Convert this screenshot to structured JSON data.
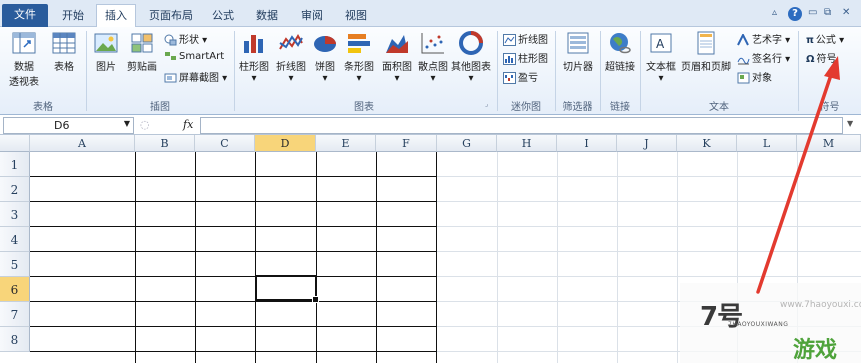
{
  "tabs": [
    "文件",
    "开始",
    "插入",
    "页面布局",
    "公式",
    "数据",
    "审阅",
    "视图"
  ],
  "ribbon": {
    "groups": {
      "tables": "表格",
      "illustrations": "插图",
      "charts": "图表",
      "sparklines": "迷你图",
      "filter": "筛选器",
      "links": "链接",
      "text": "文本",
      "symbols": "符号"
    },
    "tables": {
      "pivot_line1": "数据",
      "pivot_line2": "透视表",
      "table": "表格"
    },
    "illustrations": {
      "picture": "图片",
      "clipart": "剪贴画",
      "shapes": "形状",
      "smartart": "SmartArt",
      "screenshot": "屏幕截图"
    },
    "charts": {
      "column": "柱形图",
      "line": "折线图",
      "pie": "饼图",
      "bar": "条形图",
      "area": "面积图",
      "scatter": "散点图",
      "other": "其他图表"
    },
    "sparklines": {
      "line": "折线图",
      "column": "柱形图",
      "winloss": "盈亏"
    },
    "filter": {
      "slicer": "切片器"
    },
    "links": {
      "hyperlink": "超链接"
    },
    "text": {
      "textbox": "文本框",
      "header_footer": "页眉和页脚",
      "wordart": "艺术字",
      "signature": "签名行",
      "object": "对象"
    },
    "symbols": {
      "equation": "公式",
      "symbol": "符号"
    }
  },
  "formula_bar": {
    "name_box": "D6",
    "fx": "fx",
    "value": ""
  },
  "columns": [
    "A",
    "B",
    "C",
    "D",
    "E",
    "F",
    "G",
    "H",
    "I",
    "J",
    "K",
    "L",
    "M"
  ],
  "rows": [
    "1",
    "2",
    "3",
    "4",
    "5",
    "6",
    "7",
    "8"
  ],
  "selected": {
    "column": "D",
    "row": "6"
  },
  "watermark": {
    "brand": "7号",
    "site": "www.7haoyouxi.com",
    "sub": "7HAOYOUXIWANG",
    "green": "游戏"
  },
  "colors": {
    "accent": "#2a5c9c",
    "arrow": "#e33a2f",
    "selection": "#f8d57a"
  }
}
